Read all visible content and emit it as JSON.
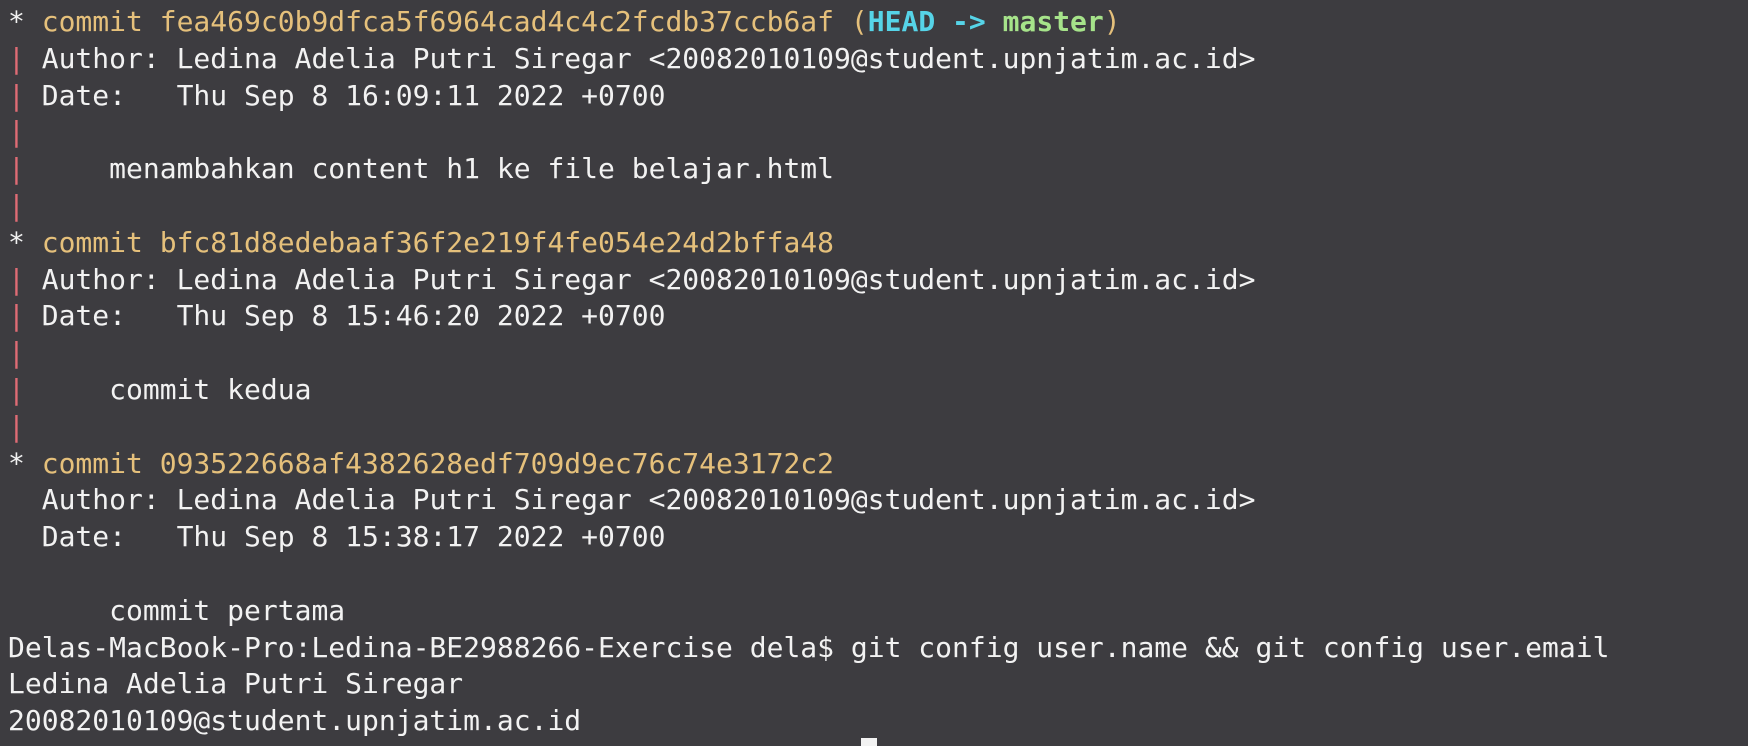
{
  "colors": {
    "background": "#3d3c40",
    "foreground": "#f2f2f2",
    "commit_yellow": "#e5c07b",
    "head_cyan": "#56d4e8",
    "branch_green": "#a6e38a",
    "graph_pink": "#e06c75"
  },
  "commits": [
    {
      "hash": "commit fea469c0b9dfca5f6964cad4c4c2fcdb37ccb6af",
      "ref_open": " (",
      "head": "HEAD",
      "arrow": " -> ",
      "branch": "master",
      "ref_close": ")",
      "author": "Author: Ledina Adelia Putri Siregar <20082010109@student.upnjatim.ac.id>",
      "date": "Date:   Thu Sep 8 16:09:11 2022 +0700",
      "message": "    menambahkan content h1 ke file belajar.html"
    },
    {
      "hash": "commit bfc81d8edebaaf36f2e219f4fe054e24d2bffa48",
      "author": "Author: Ledina Adelia Putri Siregar <20082010109@student.upnjatim.ac.id>",
      "date": "Date:   Thu Sep 8 15:46:20 2022 +0700",
      "message": "    commit kedua"
    },
    {
      "hash": "commit 093522668af4382628edf709d9ec76c74e3172c2",
      "author": "Author: Ledina Adelia Putri Siregar <20082010109@student.upnjatim.ac.id>",
      "date": "Date:   Thu Sep 8 15:38:17 2022 +0700",
      "message": "    commit pertama"
    }
  ],
  "graph": {
    "star": "*",
    "bar": "|"
  },
  "prompt": {
    "text": "Delas-MacBook-Pro:Ledina-BE2988266-Exercise dela$ git config user.name && git config user.email"
  },
  "output": {
    "user_name": "Ledina Adelia Putri Siregar",
    "user_email": "20082010109@student.upnjatim.ac.id"
  }
}
